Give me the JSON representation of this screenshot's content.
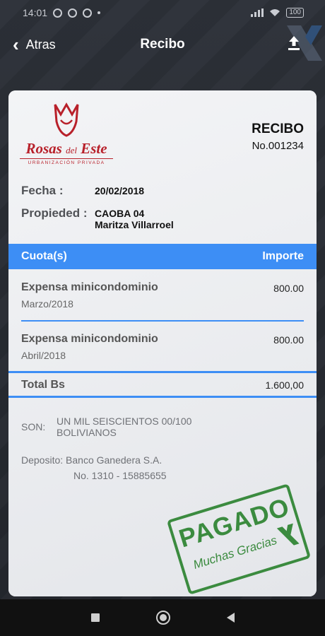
{
  "status": {
    "time": "14:01",
    "battery": "100"
  },
  "appbar": {
    "back_label": "Atras",
    "title": "Recibo"
  },
  "logo": {
    "brand_main": "Rosas ",
    "brand_small": "del",
    "brand_end": " Este",
    "subtitle": "URBANIZACIÓN PRIVADA",
    "color": "#b8202a"
  },
  "receipt": {
    "heading": "RECIBO",
    "number": "No.001234",
    "date_label": "Fecha :",
    "date_value": "20/02/2018",
    "property_label": "Propieded :",
    "property_value": "CAOBA 04",
    "owner": "Maritza Villarroel"
  },
  "table": {
    "col_fee": "Cuota(s)",
    "col_amount": "Importe",
    "items": [
      {
        "name": "Expensa minicondominio",
        "period": "Marzo/2018",
        "amount": "800.00"
      },
      {
        "name": "Expensa minicondominio",
        "period": "Abril/2018",
        "amount": "800.00"
      }
    ],
    "total_label": "Total Bs",
    "total_value": "1.600,00",
    "accent": "#3d8ef5"
  },
  "son": {
    "label": "SON:",
    "line1": "UN MIL SEISCIENTOS 00/100",
    "line2": "BOLIVIANOS"
  },
  "deposit": {
    "line1": "Deposito: Banco Ganedera S.A.",
    "line2": "No. 1310 - 15885655"
  },
  "stamp": {
    "main": "PAGADO",
    "sub": "Muchas Gracias",
    "color": "#3b8b3f"
  }
}
